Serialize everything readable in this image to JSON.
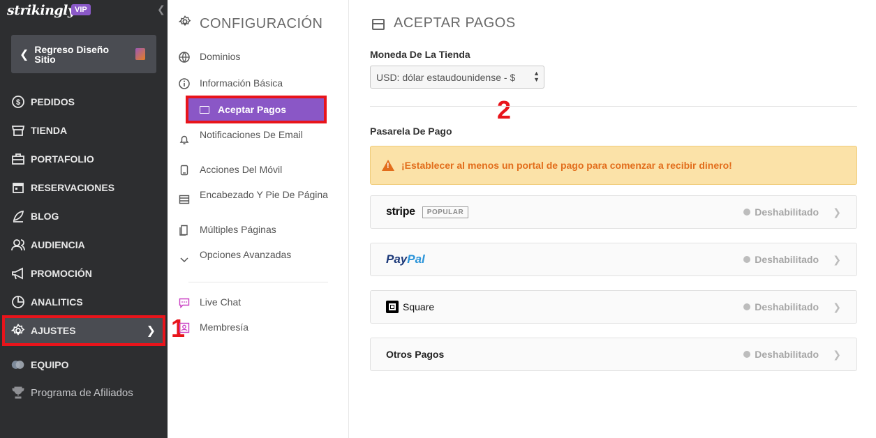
{
  "brand": {
    "logo": "strikingly",
    "badge": "VIP"
  },
  "sidebar": {
    "back_label": "Regreso Diseño Sitio",
    "items": [
      {
        "label": "PEDIDOS",
        "icon": "dollar-icon"
      },
      {
        "label": "TIENDA",
        "icon": "store-icon"
      },
      {
        "label": "PORTAFOLIO",
        "icon": "briefcase-icon"
      },
      {
        "label": "RESERVACIONES",
        "icon": "calendar-icon"
      },
      {
        "label": "BLOG",
        "icon": "pen-icon"
      },
      {
        "label": "AUDIENCIA",
        "icon": "people-icon"
      },
      {
        "label": "PROMOCIÓN",
        "icon": "megaphone-icon"
      },
      {
        "label": "ANALITICS",
        "icon": "pie-chart-icon"
      },
      {
        "label": "AJUSTES",
        "icon": "gear-icon",
        "active": true
      },
      {
        "label": "EQUIPO",
        "icon": "team-icon"
      },
      {
        "label": "Programa de Afiliados",
        "icon": "trophy-icon"
      }
    ]
  },
  "annotations": {
    "mark1": "1",
    "mark2": "2"
  },
  "settings": {
    "title": "CONFIGURACIÓN",
    "items": [
      {
        "label": "Dominios",
        "icon": "globe-icon"
      },
      {
        "label": "Información Básica",
        "icon": "info-icon"
      },
      {
        "label": "Aceptar Pagos",
        "icon": "card-icon",
        "selected": true
      },
      {
        "label": "Notificaciones De Email",
        "icon": "bell-icon"
      },
      {
        "label": "Acciones Del Móvil",
        "icon": "mobile-icon"
      },
      {
        "label": "Encabezado Y Pie De Página",
        "icon": "layout-icon"
      },
      {
        "label": "Múltiples Páginas",
        "icon": "pages-icon"
      },
      {
        "label": "Opciones Avanzadas",
        "icon": "chevron-down-icon"
      },
      {
        "label": "Live Chat",
        "icon": "chat-icon"
      },
      {
        "label": "Membresía",
        "icon": "member-icon"
      }
    ]
  },
  "main": {
    "title": "ACEPTAR PAGOS",
    "currency_label": "Moneda De La Tienda",
    "currency_value": "USD: dólar estaudounidense - $",
    "gateway_label": "Pasarela De Pago",
    "alert": "¡Establecer al menos un portal de pago para comenzar a recibir dinero!",
    "gateways": [
      {
        "name": "stripe",
        "badge": "POPULAR",
        "status": "Deshabilitado"
      },
      {
        "name_pay": "Pay",
        "name_pal": "Pal",
        "status": "Deshabilitado"
      },
      {
        "name": "Square",
        "status": "Deshabilitado"
      },
      {
        "name": "Otros Pagos",
        "status": "Deshabilitado"
      }
    ]
  },
  "colors": {
    "sidebar_bg": "#2d2e30",
    "accent_purple": "#8a57c6",
    "highlight_red": "#e8141b",
    "alert_bg": "#fbe2a8",
    "alert_text": "#e26d1b"
  }
}
